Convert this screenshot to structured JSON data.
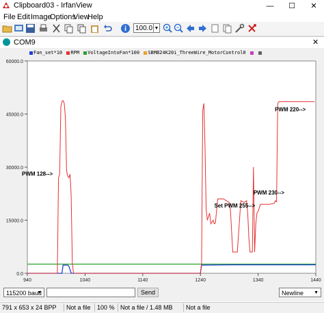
{
  "window": {
    "title": "Clipboard03 - IrfanView",
    "minimize": "—",
    "maximize": "☐",
    "close": "✕"
  },
  "menu": [
    "File",
    "Edit",
    "Image",
    "Options",
    "View",
    "Help"
  ],
  "toolbar": {
    "zoom_value": "100.0"
  },
  "plotter": {
    "title": "COM9",
    "close": "✕",
    "legend": [
      {
        "label": "Fan_set*10",
        "color": "#1f3fd6"
      },
      {
        "label": "RPM",
        "color": "#e53030"
      },
      {
        "label": "VoltageIntoFan*100",
        "color": "#2ca02c"
      },
      {
        "label": "SBMB24K20i_ThreeWire_MotorControl0",
        "color": "#f0a020"
      },
      {
        "label": "",
        "color": "#c040c0"
      },
      {
        "label": "",
        "color": "#606060"
      }
    ],
    "baud": "115200 baud",
    "send_value": "",
    "send_label": "Send",
    "line_ending": "Newline"
  },
  "status": {
    "dims": "791 x 653 x 24 BPP",
    "file1": "Not a file",
    "zoom": "100 %",
    "file2": "Not a file / 1.48 MB",
    "file3": "Not a file"
  },
  "chart_data": {
    "type": "line",
    "xlim": [
      940,
      1440
    ],
    "ylim": [
      0,
      60000
    ],
    "x_ticks": [
      "940",
      "1040",
      "1140",
      "1240",
      "1340",
      "1440"
    ],
    "y_ticks": [
      "0.0",
      "15000.0",
      "30000.0",
      "45000.0",
      "60000.0"
    ],
    "annotations": [
      "PWM 128-->",
      "PWM 220-->",
      "PWM 230-->",
      "Set PWM 255-->"
    ],
    "series": [
      {
        "name": "RPM",
        "color": "#e53030",
        "x": [
          940,
          992,
          994,
          996,
          998,
          1000,
          1002,
          1004,
          1006,
          1008,
          1010,
          1012,
          1014,
          1016,
          1018,
          1020,
          1240,
          1242,
          1244,
          1246,
          1248,
          1250,
          1252,
          1256,
          1258,
          1260,
          1262,
          1264,
          1266,
          1270,
          1280,
          1290,
          1292,
          1294,
          1296,
          1298,
          1304,
          1310,
          1316,
          1320,
          1322,
          1324,
          1326,
          1328,
          1330,
          1332,
          1334,
          1336,
          1338,
          1340,
          1344,
          1350,
          1360,
          1368,
          1370,
          1372,
          1374,
          1376,
          1380,
          1390,
          1400,
          1410,
          1420,
          1430,
          1438
        ],
        "y": [
          0,
          0,
          27000,
          28000,
          47000,
          48500,
          48800,
          48000,
          44000,
          29000,
          27500,
          27000,
          28000,
          22000,
          3000,
          0,
          0,
          3000,
          46000,
          48000,
          35000,
          18000,
          15000,
          17000,
          14000,
          14500,
          15000,
          14000,
          14200,
          21000,
          21000,
          20000,
          18000,
          12000,
          6000,
          6000,
          6000,
          20500,
          20000,
          20500,
          17000,
          10000,
          6000,
          6000,
          6000,
          30000,
          6000,
          14000,
          17000,
          17500,
          19500,
          19500,
          19500,
          19800,
          20500,
          20200,
          48000,
          48500,
          48500,
          48500,
          48500,
          48500,
          48500,
          48500,
          48500
        ]
      },
      {
        "name": "Fan_set*10",
        "color": "#1f3fd6",
        "x": [
          940,
          1000,
          1002,
          1010,
          1012,
          1016,
          1018,
          1240,
          1242,
          1300,
          1340,
          1380,
          1440
        ],
        "y": [
          0,
          0,
          2300,
          2300,
          2000,
          0,
          0,
          0,
          2300,
          2400,
          2400,
          2400,
          2400
        ]
      },
      {
        "name": "VoltageIntoFan*100",
        "color": "#2ca02c",
        "x": [
          940,
          1440
        ],
        "y": [
          2600,
          2600
        ]
      }
    ]
  }
}
